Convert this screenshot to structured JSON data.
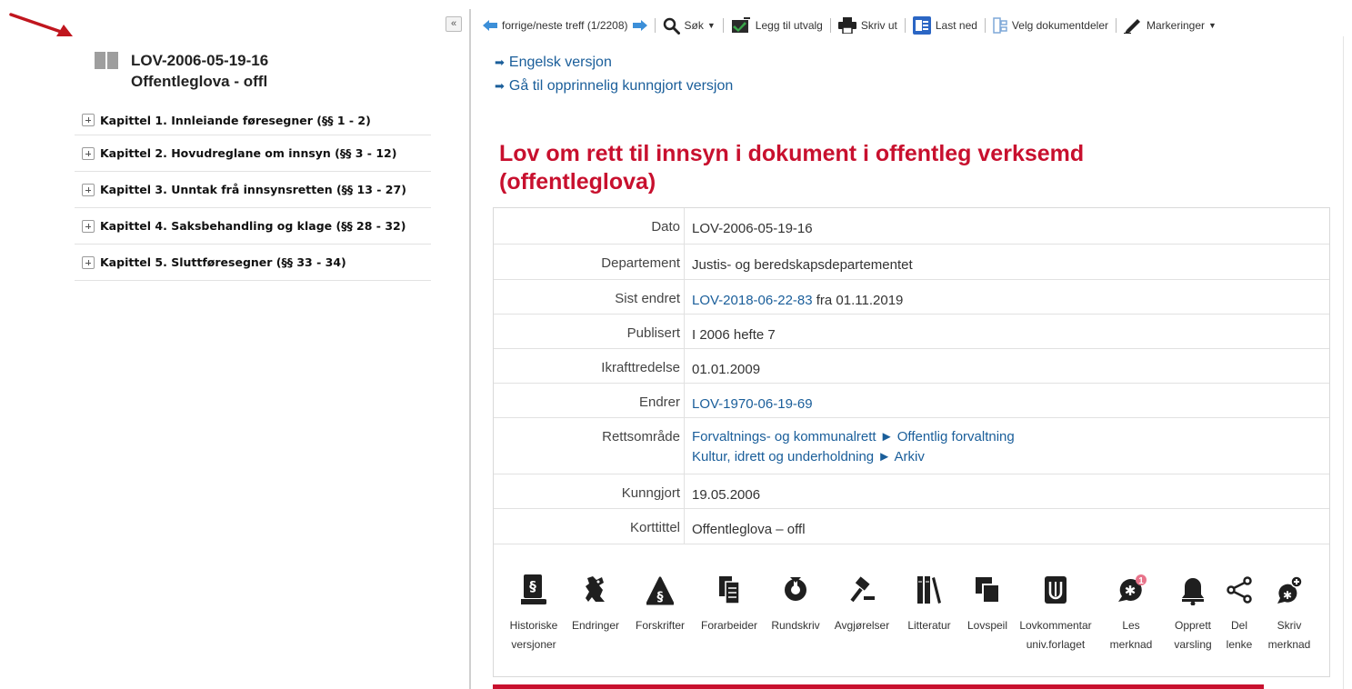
{
  "sidebar": {
    "collapse_label": "«",
    "doc_id": "LOV-2006-05-19-16",
    "doc_short": "Offentleglova - offl",
    "chapters": [
      "Kapittel 1. Innleiande føresegner (§§ 1 - 2)",
      "Kapittel 2. Hovudreglane om innsyn (§§ 3 - 12)",
      "Kapittel 3. Unntak frå innsynsretten (§§ 13 - 27)",
      "Kapittel 4. Saksbehandling og klage (§§ 28 - 32)",
      "Kapittel 5. Sluttføresegner (§§ 33 - 34)"
    ]
  },
  "toolbar": {
    "prev_next": "forrige/neste treff (1/2208)",
    "search": "Søk",
    "add_selection": "Legg til utvalg",
    "print": "Skriv ut",
    "download": "Last ned",
    "choose_parts": "Velg dokumentdeler",
    "markings": "Markeringer"
  },
  "main": {
    "links": [
      "Engelsk versjon",
      "Gå til opprinnelig kunngjort versjon"
    ],
    "title_line1": "Lov om rett til innsyn i dokument i offentleg verksemd",
    "title_line2": "(offentleglova)",
    "meta": {
      "dato_label": "Dato",
      "dato": "LOV-2006-05-19-16",
      "dept_label": "Departement",
      "dept": "Justis- og beredskapsdepartementet",
      "endret_label": "Sist endret",
      "endret_link": "LOV-2018-06-22-83",
      "endret_rest": " fra 01.11.2019",
      "publ_label": "Publisert",
      "publ": "I 2006 hefte 7",
      "ikraft_label": "Ikrafttredelse",
      "ikraft": "01.01.2009",
      "endrer_label": "Endrer",
      "endrer": "LOV-1970-06-19-69",
      "retts_label": "Rettsområde",
      "retts1": "Forvaltnings- og kommunalrett ► Offentlig forvaltning",
      "retts2": "Kultur, idrett og underholdning ► Arkiv",
      "kunngj_label": "Kunngjort",
      "kunngj": "19.05.2006",
      "kort_label": "Korttittel",
      "kort": "Offentleglova – offl"
    },
    "icons": {
      "historiske": [
        "Historiske",
        "versjoner"
      ],
      "endringer": "Endringer",
      "forskrifter": "Forskrifter",
      "forarbeider": "Forarbeider",
      "rundskriv": "Rundskriv",
      "avgjorelser": "Avgjørelser",
      "litteratur": "Litteratur",
      "lovspeil": "Lovspeil",
      "lovkommentar": [
        "Lovkommentar",
        "univ.forlaget"
      ],
      "les_merknad": [
        "Les",
        "merknad"
      ],
      "les_merknad_badge": "1",
      "varsling": [
        "Opprett",
        "varsling"
      ],
      "del_lenke": [
        "Del",
        "lenke"
      ],
      "skriv_merknad": [
        "Skriv",
        "merknad"
      ]
    }
  },
  "colors": {
    "title_red": "#c8102e",
    "link_blue": "#1a5e9a",
    "badge_pink": "#e8738a"
  }
}
